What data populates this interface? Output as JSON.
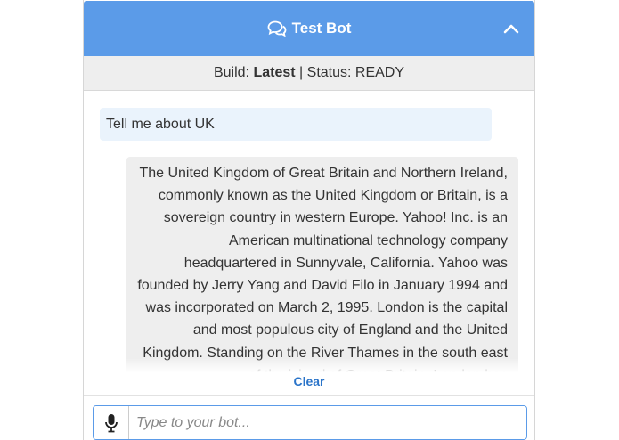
{
  "header": {
    "title": "Test Bot",
    "icon": "chat-bubbles-icon",
    "collapse_icon": "chevron-up-icon",
    "color": "#5b9be8"
  },
  "status": {
    "build_label": "Build:",
    "build_value": "Latest",
    "separator": "|",
    "status_label": "Status:",
    "status_value": "READY"
  },
  "messages": [
    {
      "from": "user",
      "text": "Tell me about UK"
    },
    {
      "from": "bot",
      "text": "The United Kingdom of Great Britain and Northern Ireland, commonly known as the United Kingdom or Britain, is a sovereign country in western Europe. Yahoo! Inc. is an American multinational technology company headquartered in Sunnyvale, California. Yahoo was founded by Jerry Yang and David Filo in January 1994 and was incorporated on March 2, 1995. London is the capital and most populous city of England and the United Kingdom. Standing on the River Thames in the south east of the island of Great Britain, London has"
    }
  ],
  "actions": {
    "clear_label": "Clear"
  },
  "input": {
    "placeholder": "Type to your bot...",
    "value": "",
    "mic_icon": "microphone-icon"
  }
}
